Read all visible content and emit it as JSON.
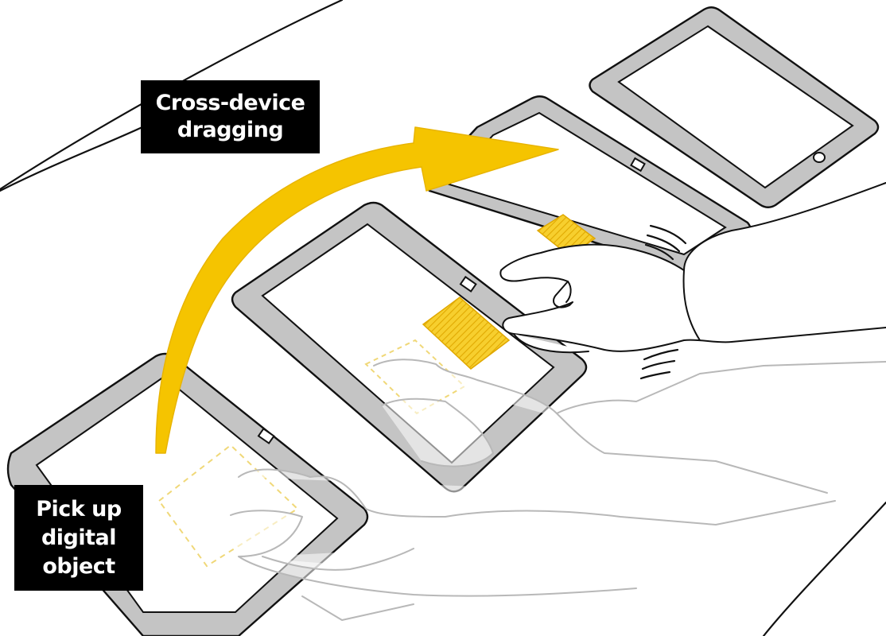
{
  "labels": {
    "cross_device": {
      "line1": "Cross-device",
      "line2": "dragging"
    },
    "pick_up": {
      "line1": "Pick up",
      "line2": "digital",
      "line3": "object"
    }
  },
  "colors": {
    "accent": "#f5c400",
    "tablet_bezel": "#c8c8c8",
    "outline": "#111111",
    "ghost": "#b8b8b8",
    "ghost_yellow": "#f0d878",
    "label_background": "#000000",
    "label_text": "#ffffff"
  },
  "icons": {
    "arrow": "curved-arrow-icon",
    "motion": "motion-lines-icon",
    "home_button": "home-button-icon"
  }
}
